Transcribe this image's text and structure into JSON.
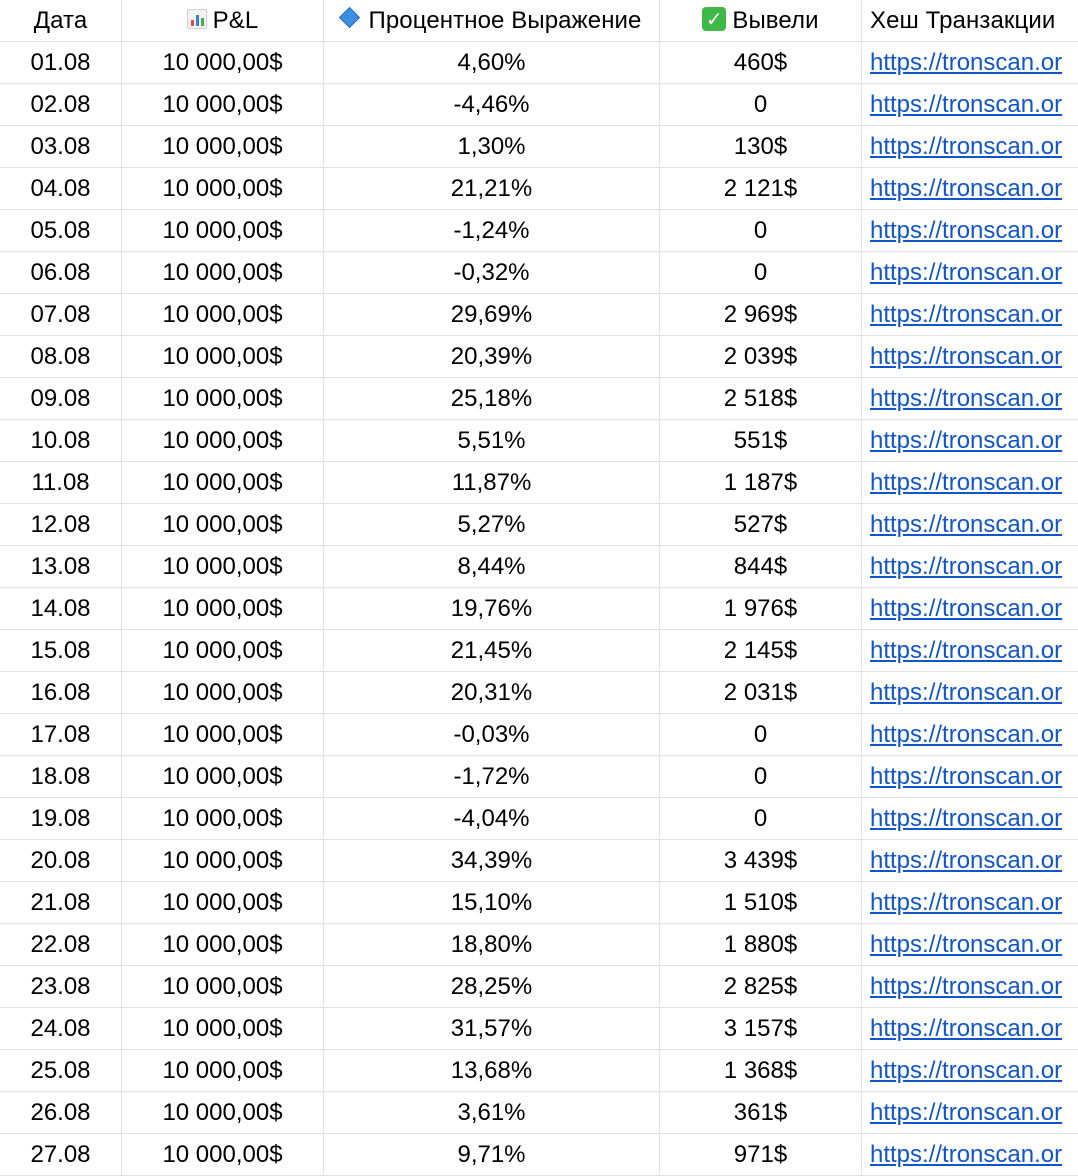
{
  "columns": [
    {
      "label": "Дата",
      "icon": null
    },
    {
      "label": "P&L",
      "icon": "bar-chart-icon"
    },
    {
      "label": "Процентное Выражение",
      "icon": "blue-diamond-icon"
    },
    {
      "label": "Вывели",
      "icon": "check-mark-icon"
    },
    {
      "label": "Хеш Транзакции",
      "icon": null
    }
  ],
  "colors": {
    "link": "#1155cc",
    "grid": "#e2e2e2",
    "check": "#3eb846",
    "diamond": "#3b8fe0"
  },
  "rows": [
    [
      "01.08",
      "10 000,00$",
      "4,60%",
      "460$",
      "https://tronscan.or"
    ],
    [
      "02.08",
      "10 000,00$",
      "-4,46%",
      "0",
      "https://tronscan.or"
    ],
    [
      "03.08",
      "10 000,00$",
      "1,30%",
      "130$",
      "https://tronscan.or"
    ],
    [
      "04.08",
      "10 000,00$",
      "21,21%",
      "2 121$",
      "https://tronscan.or"
    ],
    [
      "05.08",
      "10 000,00$",
      "-1,24%",
      "0",
      "https://tronscan.or"
    ],
    [
      "06.08",
      "10 000,00$",
      "-0,32%",
      "0",
      "https://tronscan.or"
    ],
    [
      "07.08",
      "10 000,00$",
      "29,69%",
      "2 969$",
      "https://tronscan.or"
    ],
    [
      "08.08",
      "10 000,00$",
      "20,39%",
      "2 039$",
      "https://tronscan.or"
    ],
    [
      "09.08",
      "10 000,00$",
      "25,18%",
      "2 518$",
      "https://tronscan.or"
    ],
    [
      "10.08",
      "10 000,00$",
      "5,51%",
      "551$",
      "https://tronscan.or"
    ],
    [
      "11.08",
      "10 000,00$",
      "11,87%",
      "1 187$",
      "https://tronscan.or"
    ],
    [
      "12.08",
      "10 000,00$",
      "5,27%",
      "527$",
      "https://tronscan.or"
    ],
    [
      "13.08",
      "10 000,00$",
      "8,44%",
      "844$",
      "https://tronscan.or"
    ],
    [
      "14.08",
      "10 000,00$",
      "19,76%",
      "1 976$",
      "https://tronscan.or"
    ],
    [
      "15.08",
      "10 000,00$",
      "21,45%",
      "2 145$",
      "https://tronscan.or"
    ],
    [
      "16.08",
      "10 000,00$",
      "20,31%",
      "2 031$",
      "https://tronscan.or"
    ],
    [
      "17.08",
      "10 000,00$",
      "-0,03%",
      "0",
      "https://tronscan.or"
    ],
    [
      "18.08",
      "10 000,00$",
      "-1,72%",
      "0",
      "https://tronscan.or"
    ],
    [
      "19.08",
      "10 000,00$",
      "-4,04%",
      "0",
      "https://tronscan.or"
    ],
    [
      "20.08",
      "10 000,00$",
      "34,39%",
      "3 439$",
      "https://tronscan.or"
    ],
    [
      "21.08",
      "10 000,00$",
      "15,10%",
      "1 510$",
      "https://tronscan.or"
    ],
    [
      "22.08",
      "10 000,00$",
      "18,80%",
      "1 880$",
      "https://tronscan.or"
    ],
    [
      "23.08",
      "10 000,00$",
      "28,25%",
      "2 825$",
      "https://tronscan.or"
    ],
    [
      "24.08",
      "10 000,00$",
      "31,57%",
      "3 157$",
      "https://tronscan.or"
    ],
    [
      "25.08",
      "10 000,00$",
      "13,68%",
      "1 368$",
      "https://tronscan.or"
    ],
    [
      "26.08",
      "10 000,00$",
      "3,61%",
      "361$",
      "https://tronscan.or"
    ],
    [
      "27.08",
      "10 000,00$",
      "9,71%",
      "971$",
      "https://tronscan.or"
    ]
  ]
}
